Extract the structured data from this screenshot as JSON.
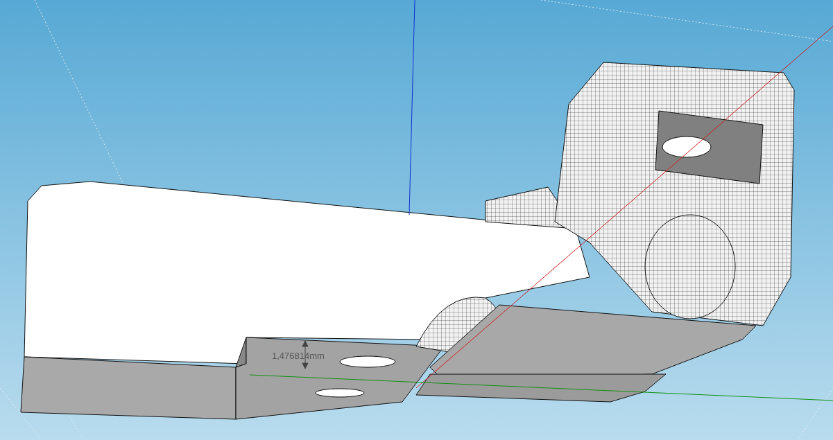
{
  "viewport": {
    "dimension_label": "1,476814mm"
  }
}
